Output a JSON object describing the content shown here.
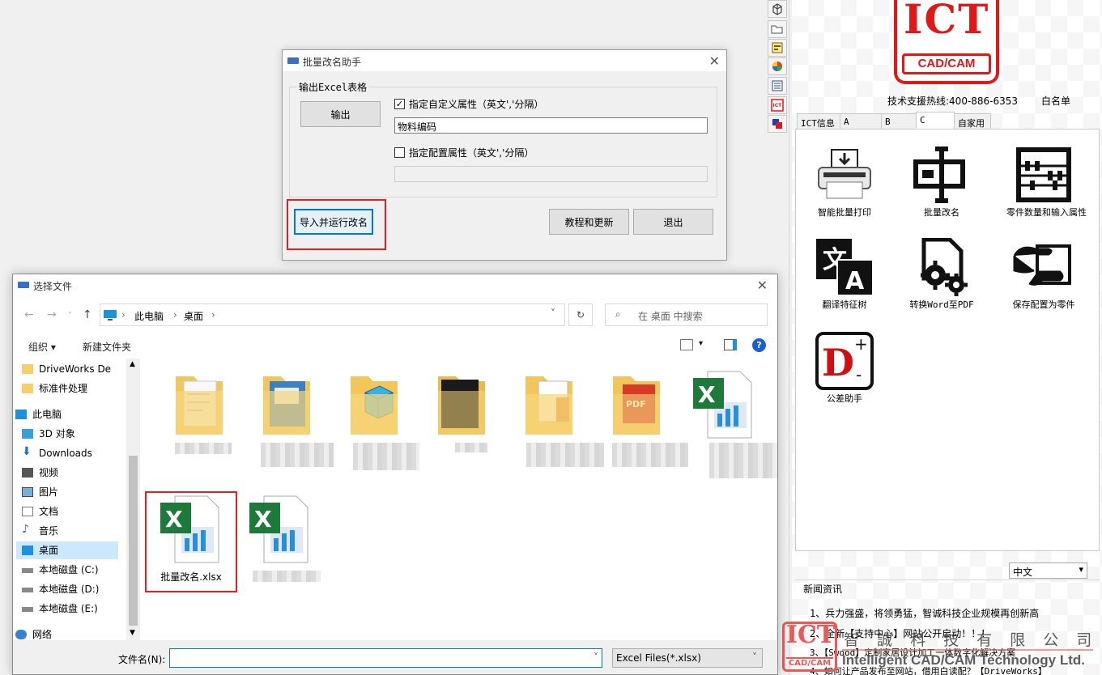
{
  "rename_dialog": {
    "title": "批量改名助手",
    "group_label": "输出Excel表格",
    "export_button": "输出",
    "custom_prop_label": "指定自定义属性（英文','分隔）",
    "custom_prop_checked": "✓",
    "custom_prop_value": "物料编码",
    "config_prop_label": "指定配置属性（英文','分隔）",
    "import_button": "导入并运行改名",
    "tutorial_button": "教程和更新",
    "exit_button": "退出"
  },
  "file_dialog": {
    "title": "选择文件",
    "breadcrumb": [
      "此电脑",
      "桌面"
    ],
    "search_placeholder": "在 桌面 中搜索",
    "organize": "组织 ▾",
    "new_folder": "新建文件夹",
    "sidebar": [
      {
        "label": "DriveWorks De",
        "icon": "folder-icon"
      },
      {
        "label": "标准件处理",
        "icon": "folder-icon"
      },
      {
        "label": "此电脑",
        "icon": "computer-icon"
      },
      {
        "label": "3D 对象",
        "icon": "cube-icon"
      },
      {
        "label": "Downloads",
        "icon": "download-icon"
      },
      {
        "label": "视频",
        "icon": "video-icon"
      },
      {
        "label": "图片",
        "icon": "picture-icon"
      },
      {
        "label": "文档",
        "icon": "document-icon"
      },
      {
        "label": "音乐",
        "icon": "music-icon"
      },
      {
        "label": "桌面",
        "icon": "desktop-icon"
      },
      {
        "label": "本地磁盘 (C:)",
        "icon": "drive-icon"
      },
      {
        "label": "本地磁盘 (D:)",
        "icon": "drive-icon"
      },
      {
        "label": "本地磁盘 (E:)",
        "icon": "drive-icon"
      },
      {
        "label": "网络",
        "icon": "network-icon"
      }
    ],
    "files": [
      {
        "name": "批量改名.xlsx",
        "type": "excel"
      }
    ],
    "filename_label": "文件名(N):",
    "filename_value": "",
    "filter": "Excel Files(*.xlsx)"
  },
  "right_panel": {
    "logo_text": "ICT",
    "logo_sub": "CAD/CAM",
    "hotline": "技术支援热线:400-886-6353",
    "whitelist": "白名单",
    "tabs": [
      "ICT信息",
      "A",
      "B",
      "C",
      "自家用"
    ],
    "active_tab": "C",
    "tools": [
      {
        "label": "智能批量打印",
        "icon": "printer-icon"
      },
      {
        "label": "批量改名",
        "icon": "rename-icon"
      },
      {
        "label": "零件数量和输入属性",
        "icon": "abacus-icon"
      },
      {
        "label": "翻译特征树",
        "icon": "translate-icon"
      },
      {
        "label": "转换Word至PDF",
        "icon": "gears-icon"
      },
      {
        "label": "保存配置为零件",
        "icon": "hand-icon"
      },
      {
        "label": "公差助手",
        "icon": "tolerance-icon"
      }
    ],
    "language": "中文",
    "news_title": "新闻资讯",
    "news": [
      "1、兵力强盛，将领勇猛，智诚科技企业规模再创新高",
      "2、全新【支持中心】网站公开启动！！！",
      "3、【Swood】定制家居设计加工一体数字化解决方案",
      "4、如何让产品发布至网站，借用白读配？【DriveWorks】"
    ],
    "watermark_cn": "智 誠 科 技 有 限 公 司",
    "watermark_en": "Intelligent CAD/CAM Technology Ltd.",
    "watermark_logo": "ICT",
    "watermark_logo_sub": "CAD/CAM"
  },
  "colors": {
    "accent_red": "#e62020",
    "selection_blue": "#cce8ff",
    "focus_blue": "#0078d7"
  }
}
